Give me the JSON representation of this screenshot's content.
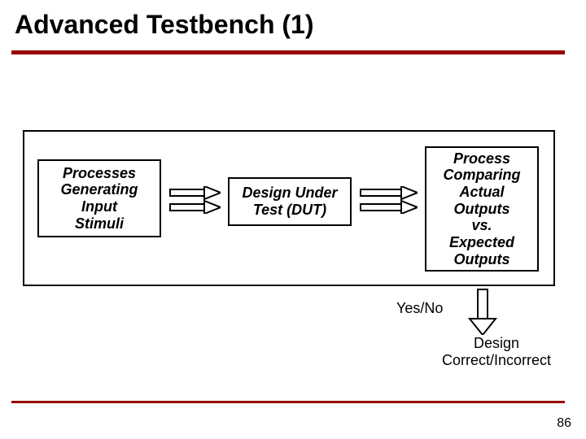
{
  "title": "Advanced Testbench (1)",
  "boxes": {
    "stimuli": "Processes\nGenerating\nInput\nStimuli",
    "dut": "Design Under\nTest (DUT)",
    "compare": "Process\nComparing\nActual\nOutputs\nvs.\nExpected\nOutputs"
  },
  "yesno_label": "Yes/No",
  "result_label": "Design\nCorrect/Incorrect",
  "page_number": "86",
  "colors": {
    "accent": "#900000"
  }
}
